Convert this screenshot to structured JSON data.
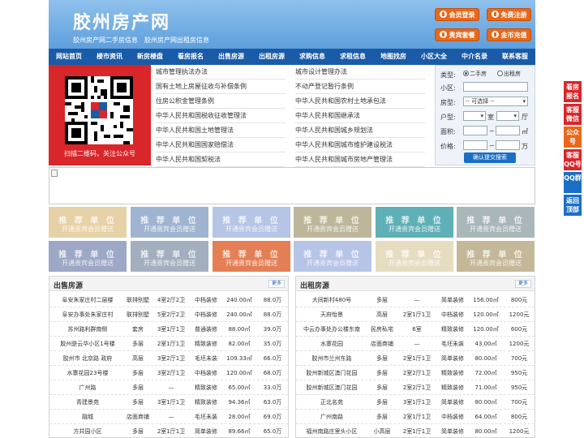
{
  "header": {
    "logo": "胶州房产网",
    "tagline": "胶州房产网二手房信息　胶州房产网出租房信息",
    "buttons": [
      {
        "label": "会员登录",
        "icon": "user-icon"
      },
      {
        "label": "免费注册",
        "icon": "register-icon"
      },
      {
        "label": "贵宾套餐",
        "icon": "vip-icon"
      },
      {
        "label": "金币充值",
        "icon": "coin-icon"
      }
    ]
  },
  "nav": [
    "网站首页",
    "楼市资讯",
    "新房楼盘",
    "看房报名",
    "出售房源",
    "出租房源",
    "求购信息",
    "求租信息",
    "地图找房",
    "小区大全",
    "中介名录",
    "联系客服"
  ],
  "qr": {
    "caption": "扫描二维码，关注公众号"
  },
  "links": {
    "left": [
      "城市管理执法办法",
      "国有土地上房屋征收与补偿条例",
      "住房公积金管理条例",
      "中华人民共和国税收征收管理法",
      "中华人民共和国土地管理法",
      "中华人民共和国国家赔偿法",
      "中华人民共和国契税法"
    ],
    "right": [
      "城市设计管理办法",
      "不动产登记暂行条例",
      "中华人民共和国农村土地承包法",
      "中华人民共和国继承法",
      "中华人民共和国城乡规划法",
      "中华人民共和国城市维护建设税法",
      "中华人民共和国城市房地产管理法"
    ]
  },
  "search": {
    "type_label": "类型:",
    "opt1": "二手房",
    "opt2": "出租房",
    "community_label": "小区:",
    "room_label": "房型:",
    "room_select": "-- 可选择 --",
    "layout_label": "户型:",
    "unit_shi": "室",
    "unit_ting": "厅",
    "area_label": "面积:",
    "area_unit": "㎡",
    "range_sep": "~",
    "price_label": "价格:",
    "price_unit": "万",
    "submit": "确认提交搜索"
  },
  "ads": {
    "title": "推 荐 单 位",
    "sub": "开通贵宾会员赠送",
    "colors": [
      "#e6d2a6",
      "#9fb4d1",
      "#b6c4e6",
      "#bdb69a",
      "#5fb0b6",
      "#a9b6ba",
      "#9da7c6",
      "#a3afbe",
      "#e47f55",
      "#b6c4e6",
      "#e6dcc0",
      "#c4b898"
    ]
  },
  "sale": {
    "title": "出售房源",
    "more": "更多",
    "rows": [
      [
        "阜安朱家庄村二层楼",
        "联排别墅",
        "4室2厅2卫",
        "中档装修",
        "240.00㎡",
        "88.0万"
      ],
      [
        "阜安办事处朱家庄村",
        "联排别墅",
        "5室2厅2卫",
        "中档装修",
        "240.00㎡",
        "88.0万"
      ],
      [
        "苏州路利群南侧",
        "套房",
        "3室1厅1卫",
        "普通装修",
        "88.00㎡",
        "39.0万"
      ],
      [
        "胶州是云华小区1号楼",
        "多层",
        "2室1厅1卫",
        "精致装修",
        "82.00㎡",
        "35.0万"
      ],
      [
        "胶州市 北京路 政府",
        "高层",
        "3室2厅1卫",
        "毛坯未装",
        "109.33㎡",
        "66.0万"
      ],
      [
        "水寨花园23号楼",
        "多层",
        "3室2厅1卫",
        "中档装修",
        "120.00㎡",
        "68.0万"
      ],
      [
        "广州路",
        "多层",
        "—",
        "精致装修",
        "65.00㎡",
        "33.0万"
      ],
      [
        "青建景苑",
        "多层",
        "3室1厅1卫",
        "精致装修",
        "94.36㎡",
        "63.0万"
      ],
      [
        "融城",
        "店面商铺",
        "—",
        "毛坯未装",
        "28.00㎡",
        "69.0万"
      ],
      [
        "方井园小区",
        "多层",
        "2室1厅1卫",
        "简单装修",
        "89.66㎡",
        "65.0万"
      ]
    ]
  },
  "rent": {
    "title": "出租房源",
    "more": "更多",
    "rows": [
      [
        "大同新村480号",
        "多层",
        "—",
        "简单装修",
        "156.00㎡",
        "800元"
      ],
      [
        "天府怡景",
        "高层",
        "2室1厅1卫",
        "中档装修",
        "120.00㎡",
        "1200元"
      ],
      [
        "中云办事处办公楼东南",
        "民房私宅",
        "6室",
        "精致装修",
        "120.00㎡",
        "600元"
      ],
      [
        "水寨花园",
        "店面商铺",
        "—",
        "毛坯未装",
        "43.00㎡",
        "1200元"
      ],
      [
        "胶州市兰州东路",
        "多层",
        "2室1厅1卫",
        "简单装修",
        "80.00㎡",
        "700元"
      ],
      [
        "胶州新城区澳门花园",
        "多层",
        "2室2厅1卫",
        "精致装修",
        "72.00㎡",
        "950元"
      ],
      [
        "胶州新城区澳门花园",
        "多层",
        "2室2厅1卫",
        "精致装修",
        "71.00㎡",
        "950元"
      ],
      [
        "正北名苑",
        "多层",
        "3室1厅1卫",
        "简单装修",
        "80.00㎡",
        "700元"
      ],
      [
        "广州南路",
        "多层",
        "2室1厅1卫",
        "中档装修",
        "64.00㎡",
        "800元"
      ],
      [
        "福州南路庄里头小区",
        "小高层",
        "2室1厅1卫",
        "简单装修",
        "80.00㎡",
        "1200元"
      ]
    ]
  },
  "sidebar": [
    {
      "label": "看房报名",
      "color": "#d8262a"
    },
    {
      "label": "客服微信",
      "color": "#d8262a"
    },
    {
      "label": "公众号",
      "color": "#e8681a"
    },
    {
      "label": "客服QQ号",
      "color": "#d8262a"
    },
    {
      "label": "QQ群",
      "color": "#1a6ec4"
    },
    {
      "label": "返回顶部",
      "color": "#1a6ec4"
    }
  ]
}
